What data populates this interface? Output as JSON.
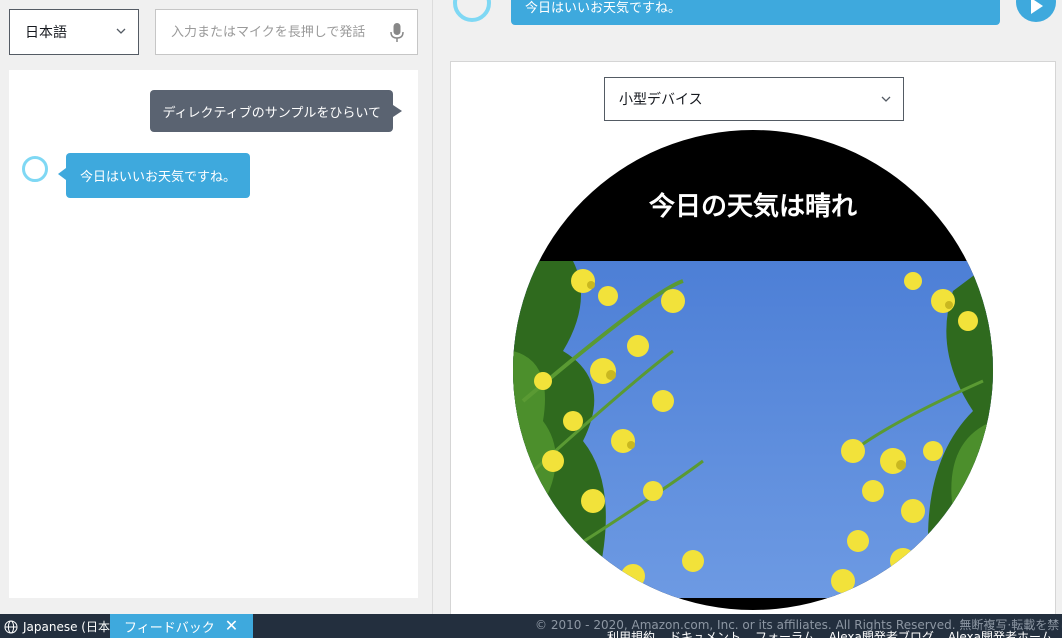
{
  "input": {
    "language": "日本語",
    "placeholder": "入力またはマイクを長押しで発話"
  },
  "conversation": {
    "user_message": "ディレクティブのサンプルをひらいて",
    "alexa_reply": "今日はいいお天気ですね。"
  },
  "preview": {
    "top_reply": "今日はいいお天気ですね。",
    "device": "小型デバイス",
    "screen_title": "今日の天気は晴れ"
  },
  "footer": {
    "locale": "Japanese (日本語)",
    "feedback": "フィードバック",
    "close_symbol": "✕",
    "copyright": "© 2010 - 2020, Amazon.com, Inc. or its affiliates. All Rights Reserved. 無断複写·転載を禁じます",
    "links": [
      "利用規約",
      "ドキュメント",
      "フォーラム",
      "Alexa開発者ブログ",
      "Alexa開発者ホーム"
    ]
  },
  "colors": {
    "alexa_blue": "#3ea9dd",
    "user_bubble": "#5a6371",
    "footer_bg": "#232f3e"
  }
}
